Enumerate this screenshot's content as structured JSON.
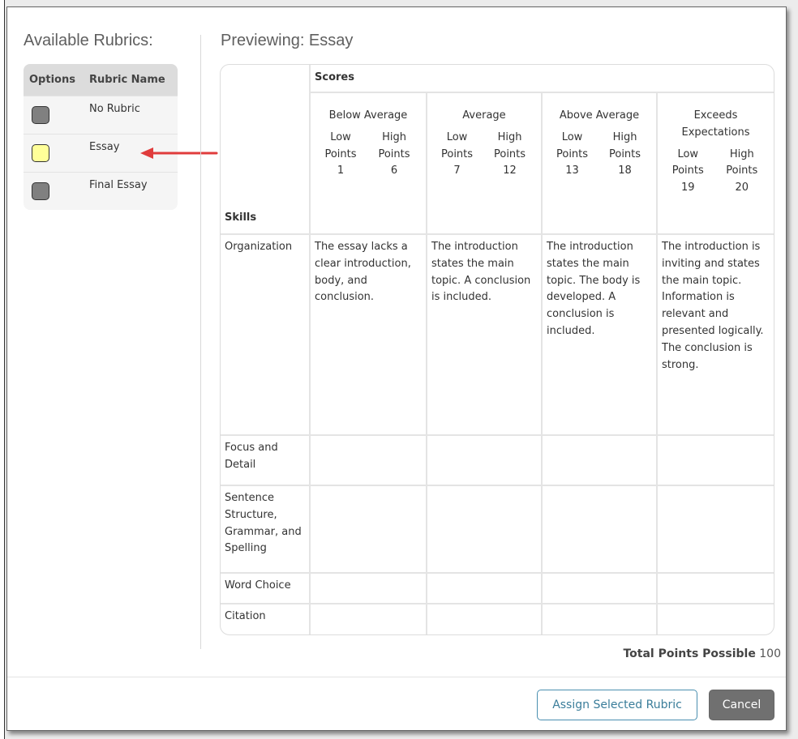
{
  "left": {
    "title": "Available Rubrics:",
    "col_options": "Options",
    "col_name": "Rubric Name",
    "rubrics": [
      {
        "name": "No Rubric",
        "color": "#808080"
      },
      {
        "name": "Essay",
        "color": "#ffff99"
      },
      {
        "name": "Final Essay",
        "color": "#808080"
      }
    ]
  },
  "preview": {
    "title": "Previewing: Essay",
    "skills_label": "Skills",
    "scores_label": "Scores",
    "levels": [
      {
        "name": "Below Average",
        "low_label": "Low Points",
        "high_label": "High Points",
        "low": "1",
        "high": "6"
      },
      {
        "name": "Average",
        "low_label": "Low Points",
        "high_label": "High Points",
        "low": "7",
        "high": "12"
      },
      {
        "name": "Above Average",
        "low_label": "Low Points",
        "high_label": "High Points",
        "low": "13",
        "high": "18"
      },
      {
        "name": "Exceeds Expectations",
        "low_label": "Low Points",
        "high_label": "High Points",
        "low": "19",
        "high": "20"
      }
    ],
    "skills": [
      {
        "name": "Organization",
        "cells": [
          "The essay lacks a clear introduction, body, and conclusion.",
          "The introduction states the main topic. A conclusion is included.",
          "The introduction states the main topic. The body is developed. A conclusion is included.",
          "The introduction is inviting and states the main topic. Information is relevant and presented logically. The conclusion is strong."
        ]
      },
      {
        "name": "Focus and Detail",
        "cells": [
          "",
          "",
          "",
          ""
        ]
      },
      {
        "name": "Sentence Structure, Grammar, and Spelling",
        "cells": [
          "",
          "",
          "",
          ""
        ]
      },
      {
        "name": "Word Choice",
        "cells": [
          "",
          "",
          "",
          ""
        ]
      },
      {
        "name": "Citation",
        "cells": [
          "",
          "",
          "",
          ""
        ]
      }
    ],
    "total_label": "Total Points Possible",
    "total_value": "100"
  },
  "footer": {
    "assign_label": "Assign Selected Rubric",
    "cancel_label": "Cancel"
  },
  "colors": {
    "accent": "#4a8fb0",
    "arrow": "#e03c3c"
  }
}
